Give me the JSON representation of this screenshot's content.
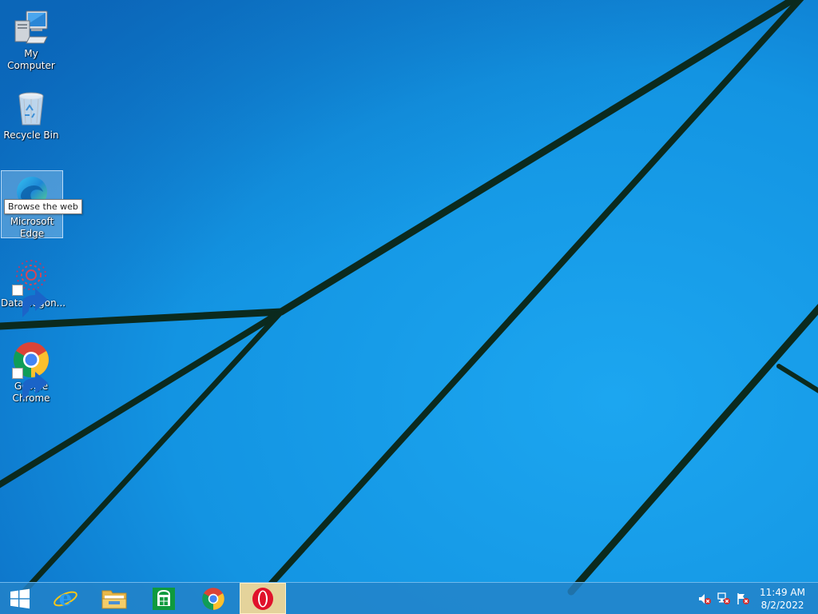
{
  "desktop": {
    "icons": [
      {
        "label": "My Computer",
        "icon": "computer-icon"
      },
      {
        "label": "Recycle Bin",
        "icon": "recycle-bin-icon"
      },
      {
        "label": "Microsoft Edge",
        "icon": "edge-icon"
      },
      {
        "label": "DataWagon...",
        "icon": "datawagon-icon"
      },
      {
        "label": "Google Chrome",
        "icon": "chrome-icon"
      }
    ],
    "tooltip": "Browse the web"
  },
  "taskbar": {
    "buttons": [
      {
        "name": "start",
        "icon": "windows-logo-icon"
      },
      {
        "name": "internet-explorer",
        "icon": "ie-icon"
      },
      {
        "name": "file-explorer",
        "icon": "folder-icon"
      },
      {
        "name": "store",
        "icon": "store-icon"
      },
      {
        "name": "chrome",
        "icon": "chrome-icon"
      },
      {
        "name": "opera",
        "icon": "opera-icon",
        "active": true
      }
    ],
    "tray": [
      {
        "icon": "volume-muted-icon"
      },
      {
        "icon": "network-error-icon"
      },
      {
        "icon": "action-center-flag-icon"
      }
    ],
    "clock": {
      "time": "11:49 AM",
      "date": "8/2/2022"
    }
  },
  "colors": {
    "wallpaper": "#1296e4",
    "lines": "#0b2a1e",
    "taskbar": "#2382c8"
  }
}
